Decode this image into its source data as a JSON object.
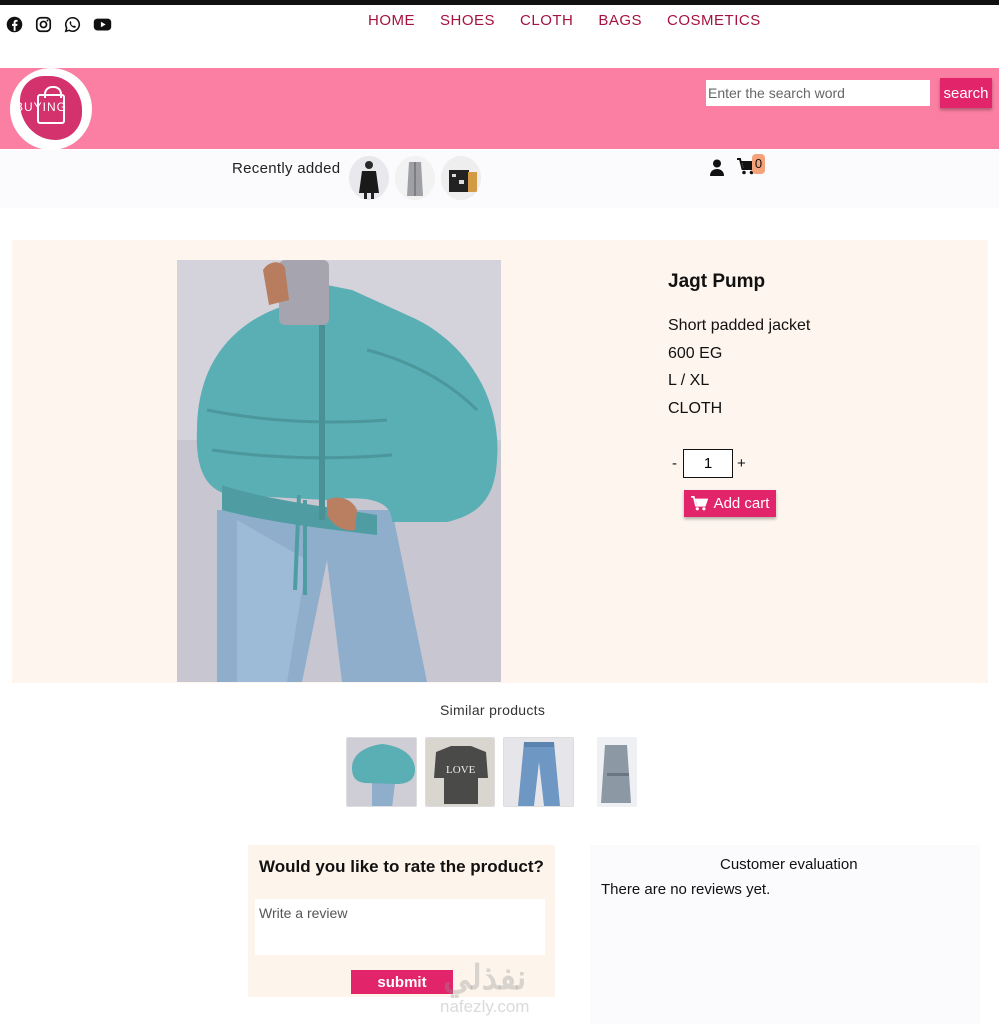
{
  "social": [
    "facebook-icon",
    "instagram-icon",
    "whatsapp-icon",
    "youtube-icon"
  ],
  "nav": {
    "home": "HOME",
    "shoes": "SHOES",
    "cloth": "CLOTH",
    "bags": "BAGS",
    "cosmetics": "COSMETICS"
  },
  "logo": {
    "text": "BUYING"
  },
  "search": {
    "placeholder": "Enter the search word",
    "button": "search"
  },
  "recent": {
    "label": "Recently added"
  },
  "cart": {
    "count": "0"
  },
  "product": {
    "name": "Jagt Pump",
    "description": "Short padded jacket",
    "price": "600 EG",
    "sizes": "L / XL",
    "category": "CLOTH",
    "quantity": "1",
    "minus": "-",
    "plus": "+",
    "add_cart": "Add cart"
  },
  "similar": {
    "title": "Similar products"
  },
  "rating": {
    "title": "Would you like to rate the product?",
    "placeholder": "Write a review",
    "submit": "submit"
  },
  "evaluation": {
    "title": "Customer evaluation",
    "empty": "There are no reviews yet."
  },
  "watermark": {
    "arabic": "نفذلي",
    "latin": "nafezly.com"
  },
  "colors": {
    "accent": "#e2246a",
    "banner": "#fb7fa2",
    "nav": "#a4123f",
    "panel": "#fdf5ee",
    "jacket": "#5aafb4"
  }
}
